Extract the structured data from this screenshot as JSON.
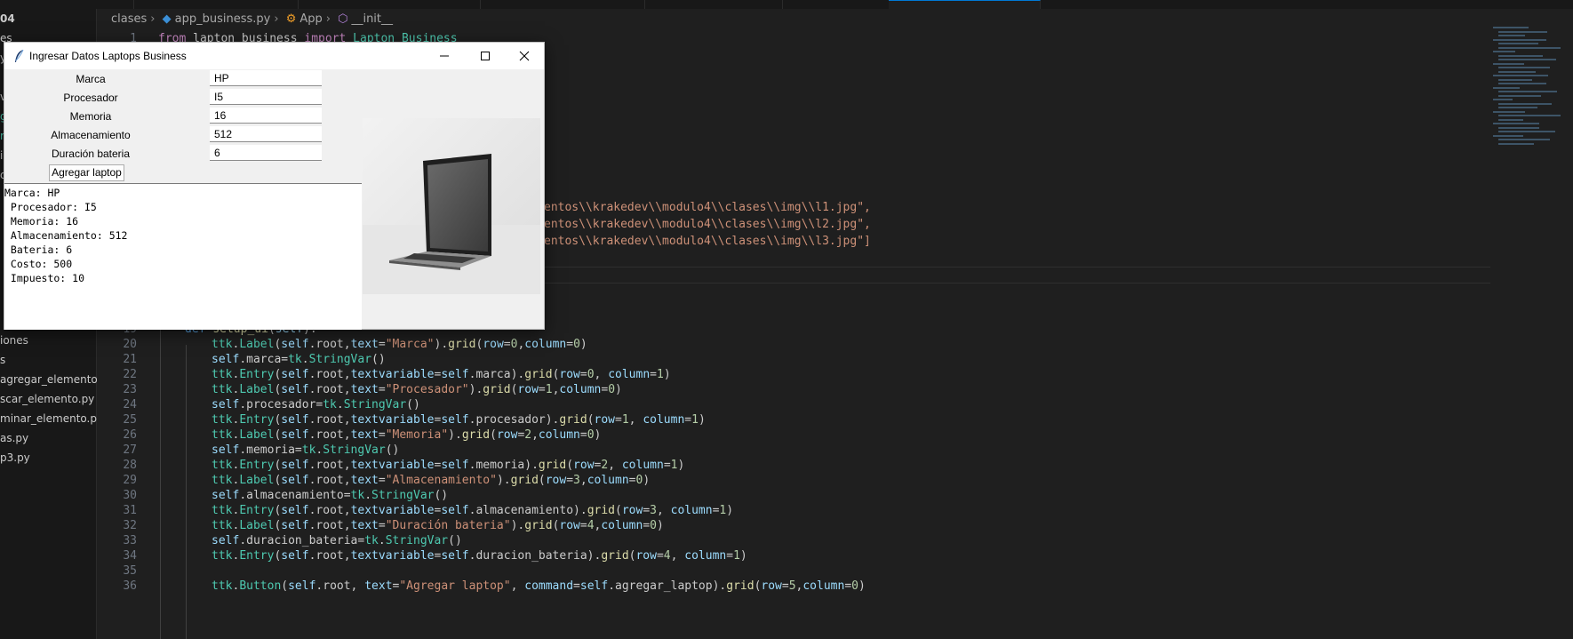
{
  "editor": {
    "breadcrumb": [
      "clases",
      "app_business.py",
      "App",
      "__init__"
    ],
    "explorer_items": [
      "04",
      "es",
      "y",
      "v",
      "g",
      "r",
      "i",
      "d",
      "iones",
      "s",
      "agregar_elemento.py",
      "scar_elemento.py",
      "minar_elemento.py",
      "as.py",
      "p3.py"
    ],
    "code_top": [
      {
        "num": "1",
        "text": "from lapton_business import Lapton_Business"
      }
    ],
    "code_paths": [
      "entos\\\\krakedev\\\\modulo4\\\\clases\\\\img\\\\l1.jpg\",",
      "entos\\\\krakedev\\\\modulo4\\\\clases\\\\img\\\\l2.jpg\",",
      "entos\\\\krakedev\\\\modulo4\\\\clases\\\\img\\\\l3.jpg\"]"
    ],
    "code_lines": [
      {
        "num": "19",
        "text": "def setup_ui(self):"
      },
      {
        "num": "20",
        "text": "ttk.Label(self.root,text=\"Marca\").grid(row=0,column=0)"
      },
      {
        "num": "21",
        "text": "self.marca=tk.StringVar()"
      },
      {
        "num": "22",
        "text": "ttk.Entry(self.root,textvariable=self.marca).grid(row=0, column=1)"
      },
      {
        "num": "23",
        "text": "ttk.Label(self.root,text=\"Procesador\").grid(row=1,column=0)"
      },
      {
        "num": "24",
        "text": "self.procesador=tk.StringVar()"
      },
      {
        "num": "25",
        "text": "ttk.Entry(self.root,textvariable=self.procesador).grid(row=1, column=1)"
      },
      {
        "num": "26",
        "text": "ttk.Label(self.root,text=\"Memoria\").grid(row=2,column=0)"
      },
      {
        "num": "27",
        "text": "self.memoria=tk.StringVar()"
      },
      {
        "num": "28",
        "text": "ttk.Entry(self.root,textvariable=self.memoria).grid(row=2, column=1)"
      },
      {
        "num": "29",
        "text": "ttk.Label(self.root,text=\"Almacenamiento\").grid(row=3,column=0)"
      },
      {
        "num": "30",
        "text": "self.almacenamiento=tk.StringVar()"
      },
      {
        "num": "31",
        "text": "ttk.Entry(self.root,textvariable=self.almacenamiento).grid(row=3, column=1)"
      },
      {
        "num": "32",
        "text": "ttk.Label(self.root,text=\"Duración bateria\").grid(row=4,column=0)"
      },
      {
        "num": "33",
        "text": "self.duracion_bateria=tk.StringVar()"
      },
      {
        "num": "34",
        "text": "ttk.Entry(self.root,textvariable=self.duracion_bateria).grid(row=4, column=1)"
      },
      {
        "num": "35",
        "text": ""
      },
      {
        "num": "36",
        "text": "ttk.Button(self.root, text=\"Agregar laptop\", command=self.agregar_laptop).grid(row=5,column=0)"
      }
    ]
  },
  "tk_window": {
    "title": "Ingresar Datos Laptops Business",
    "fields": [
      {
        "label": "Marca",
        "value": "HP"
      },
      {
        "label": "Procesador",
        "value": "I5"
      },
      {
        "label": "Memoria",
        "value": "16"
      },
      {
        "label": "Almacenamiento",
        "value": "512"
      },
      {
        "label": "Duración bateria",
        "value": "6"
      }
    ],
    "add_button": "Agregar laptop",
    "output_lines": [
      "Marca: HP",
      " Procesador: I5",
      " Memoria: 16",
      " Almacenamiento: 512",
      " Bateria: 6",
      " Costo: 500",
      " Impuesto: 10"
    ]
  }
}
